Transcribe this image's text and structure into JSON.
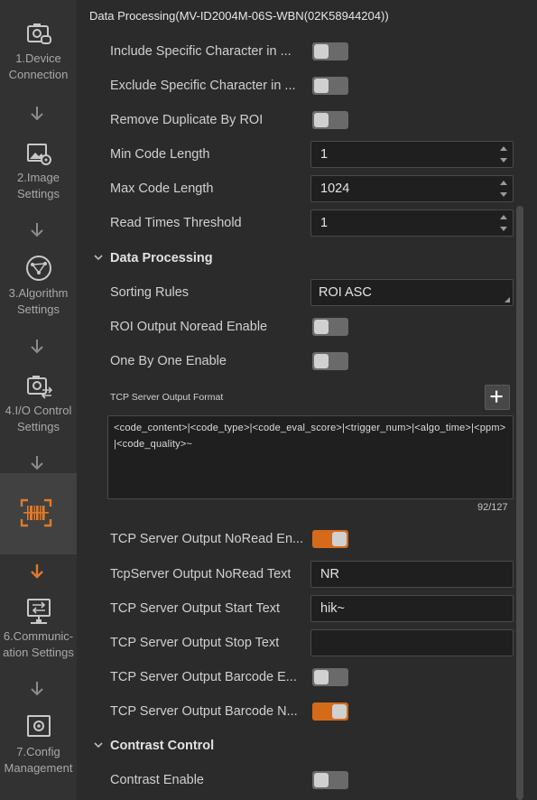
{
  "sidebar": {
    "steps": [
      {
        "line1": "1.Device",
        "line2": "Connection"
      },
      {
        "line1": "2.Image",
        "line2": "Settings"
      },
      {
        "line1": "3.Algorithm",
        "line2": "Settings"
      },
      {
        "line1": "4.I/O Control",
        "line2": "Settings"
      },
      {
        "line1": "",
        "line2": ""
      },
      {
        "line1": "6.Communic-",
        "line2": "ation Settings"
      },
      {
        "line1": "7.Config",
        "line2": "Management"
      }
    ],
    "active_step_icon": "barcode-scan-icon"
  },
  "panel": {
    "title": "Data Processing(MV-ID2004M-06S-WBN(02K58944204))",
    "rows": {
      "include_specific_char": {
        "label": "Include Specific Character in ...",
        "enabled": false
      },
      "exclude_specific_char": {
        "label": "Exclude Specific Character in ...",
        "enabled": false
      },
      "remove_duplicate": {
        "label": "Remove Duplicate By ROI",
        "enabled": false
      },
      "min_code_length": {
        "label": "Min Code Length",
        "value": "1"
      },
      "max_code_length": {
        "label": "Max Code Length",
        "value": "1024"
      },
      "read_times_threshold": {
        "label": "Read Times Threshold",
        "value": "1"
      }
    },
    "data_processing": {
      "title": "Data Processing",
      "sorting_rules": {
        "label": "Sorting Rules",
        "value": "ROI ASC"
      },
      "roi_output_noread": {
        "label": "ROI Output Noread Enable",
        "enabled": false
      },
      "one_by_one": {
        "label": "One By One Enable",
        "enabled": false
      },
      "tcp_format": {
        "label": "TCP Server Output Format",
        "value": "<code_content>|<code_type>|<code_eval_score>|<trigger_num>|<algo_time>|<ppm>|<code_quality>~",
        "count": "92/127"
      },
      "tcp_noread_enable": {
        "label": "TCP Server Output NoRead En...",
        "enabled": true
      },
      "tcp_noread_text": {
        "label": "TcpServer Output NoRead Text",
        "value": "NR"
      },
      "tcp_start_text": {
        "label": "TCP Server Output Start Text",
        "value": "hik~"
      },
      "tcp_stop_text": {
        "label": "TCP Server Output Stop Text",
        "value": ""
      },
      "tcp_barcode_e": {
        "label": "TCP Server Output Barcode E...",
        "enabled": false
      },
      "tcp_barcode_n": {
        "label": "TCP Server Output Barcode N...",
        "enabled": true
      }
    },
    "contrast_control": {
      "title": "Contrast Control",
      "contrast_enable": {
        "label": "Contrast Enable",
        "enabled": false
      }
    }
  },
  "colors": {
    "accent": "#d46a1a",
    "background": "#2b2b2b",
    "sidebar": "#323232"
  }
}
